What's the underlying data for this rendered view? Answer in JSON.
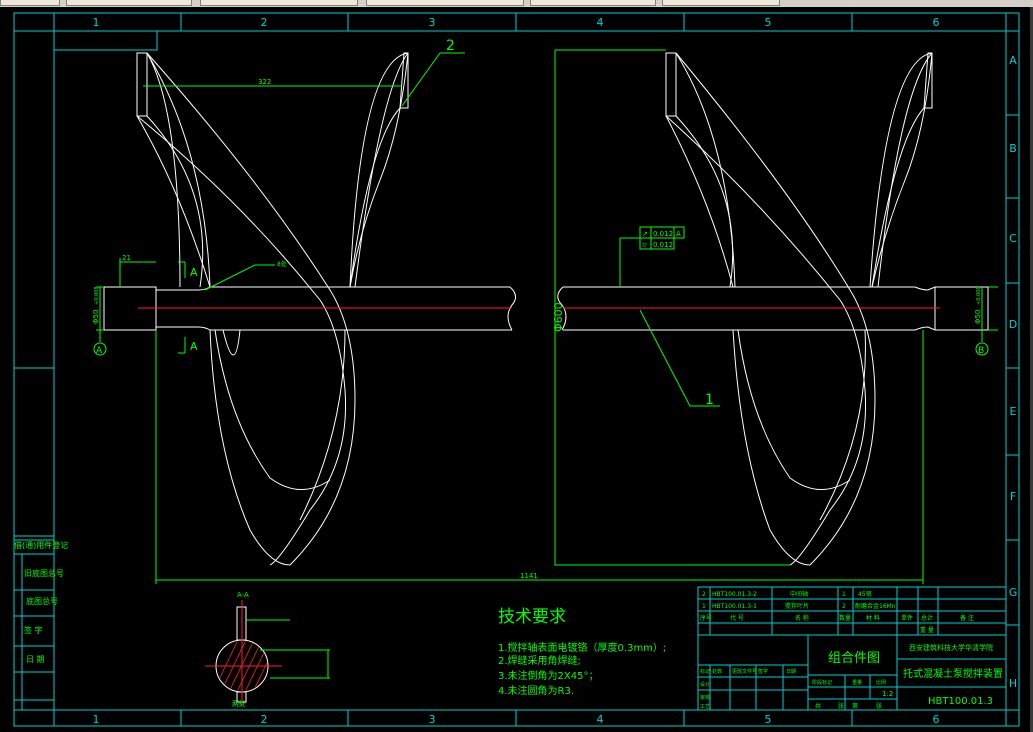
{
  "app": {
    "top_strip_tabs": [
      "",
      "",
      "",
      "",
      "",
      ""
    ]
  },
  "drawing": {
    "border_columns": [
      "1",
      "2",
      "3",
      "4",
      "5",
      "6"
    ],
    "border_rows": [
      "A",
      "B",
      "C",
      "D",
      "E",
      "F",
      "G",
      "H"
    ],
    "balloons": {
      "part1": "1",
      "part2": "2"
    },
    "dimensions": {
      "overall_length": "1141",
      "blade_pitch": "322",
      "shaft_end_length": "21",
      "blade_diameter": "Φ600",
      "shaft_left_dia": "Φ50",
      "shaft_right_dia": "Φ50",
      "tol_upper": "+0.008",
      "tol_lower": "-0.008"
    },
    "datums": {
      "left": "A",
      "right": "B"
    },
    "section_marks": {
      "top": "A",
      "bottom": "A"
    },
    "weld_symbol": {
      "text": "8处"
    },
    "gdt": {
      "row1_symbol": "↗",
      "row1_value": "0.012",
      "row1_datum": "A",
      "row2_symbol": "⌭",
      "row2_value": "0.012"
    },
    "section_view": {
      "title": "A-A",
      "note": "两处"
    },
    "tech_requirements": {
      "title": "技术要求",
      "items": [
        "1.搅拌轴表面电镀铬（厚度0.3mm）;",
        "2.焊缝采用角焊缝;",
        "3.未注倒角为2X45°；",
        "4.未注圆角为R3."
      ]
    },
    "left_sidebar": [
      "借(通)用件登记",
      "旧底图总号",
      "底图总号",
      "签 字",
      "日 期"
    ],
    "title_block": {
      "bom_rows": [
        [
          "2",
          "HBT100.01.3-2",
          "中间轴",
          "1",
          "45钢",
          "",
          "",
          ""
        ],
        [
          "1",
          "HBT100.01.3-1",
          "搅拌叶片",
          "2",
          "耐磨合金16Mn",
          "",
          "",
          ""
        ]
      ],
      "bom_header": [
        "序号",
        "代  号",
        "名  称",
        "数量",
        "材  料",
        "单件",
        "总计",
        "备  注"
      ],
      "mass_label": "重 量",
      "drawing_name": "组合件图",
      "school": "西安建筑科技大学华清学院",
      "product": "托式混凝土泵搅拌装置",
      "scale_label": "比例",
      "scale": "1:2",
      "drawing_number": "HBT100.01.3",
      "sheet_labels": [
        "共",
        "张",
        "第",
        "张"
      ],
      "change_headers": [
        "标记",
        "处数",
        "更改文件号",
        "签字",
        "日期"
      ],
      "roles": [
        "设计",
        "审核",
        "工艺"
      ],
      "stage_headers": [
        "阶段标记",
        "重量",
        "比例"
      ]
    }
  },
  "colors": {
    "background": "#000000",
    "geometry": "#ffffff",
    "annotation": "#00ff00",
    "frame": "#00d0d0",
    "centerline": "#ff2020"
  }
}
